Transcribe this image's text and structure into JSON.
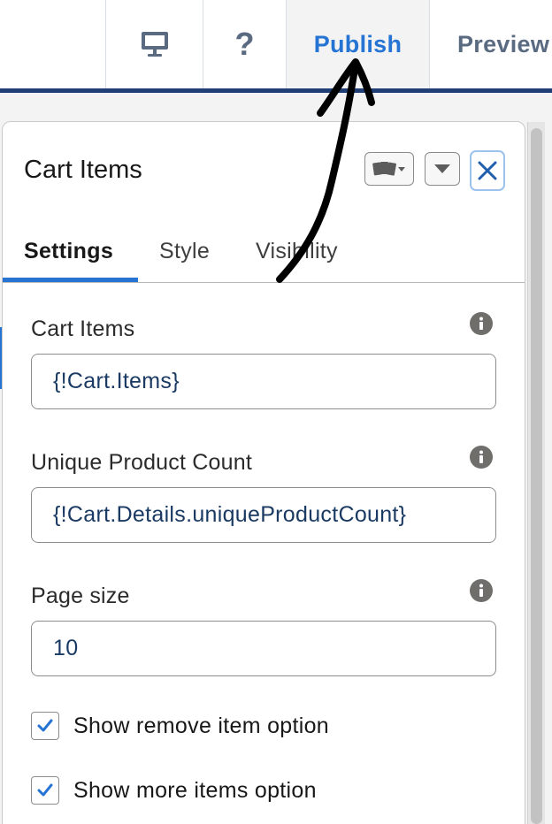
{
  "toolbar": {
    "device_icon": "desktop-monitor-icon",
    "help_label": "?",
    "publish_label": "Publish",
    "preview_label": "Preview"
  },
  "panel": {
    "title": "Cart Items",
    "header_buttons": {
      "variant_icon": "component-variant-icon",
      "collapse_icon": "chevron-down-icon",
      "close_icon": "close-icon"
    },
    "tabs": [
      {
        "label": "Settings",
        "active": true
      },
      {
        "label": "Style",
        "active": false
      },
      {
        "label": "Visibility",
        "active": false
      }
    ],
    "fields": [
      {
        "label": "Cart Items",
        "value": "{!Cart.Items}",
        "info_icon": "info-icon"
      },
      {
        "label": "Unique Product Count",
        "value": "{!Cart.Details.uniqueProductCount}",
        "info_icon": "info-icon"
      },
      {
        "label": "Page size",
        "value": "10",
        "info_icon": "info-icon"
      }
    ],
    "checkboxes": [
      {
        "label": "Show remove item option",
        "checked": true
      },
      {
        "label": "Show more items option",
        "checked": true
      }
    ]
  },
  "annotation": {
    "type": "hand-drawn-arrow",
    "points_to": "Publish"
  },
  "colors": {
    "accent": "#2574d3",
    "toolbar_rule": "#1f3f76",
    "toolbar_muted": "#5a6a80",
    "input_text": "#1a3a63",
    "info_icon": "#706e6b",
    "annotation": "#000000"
  }
}
